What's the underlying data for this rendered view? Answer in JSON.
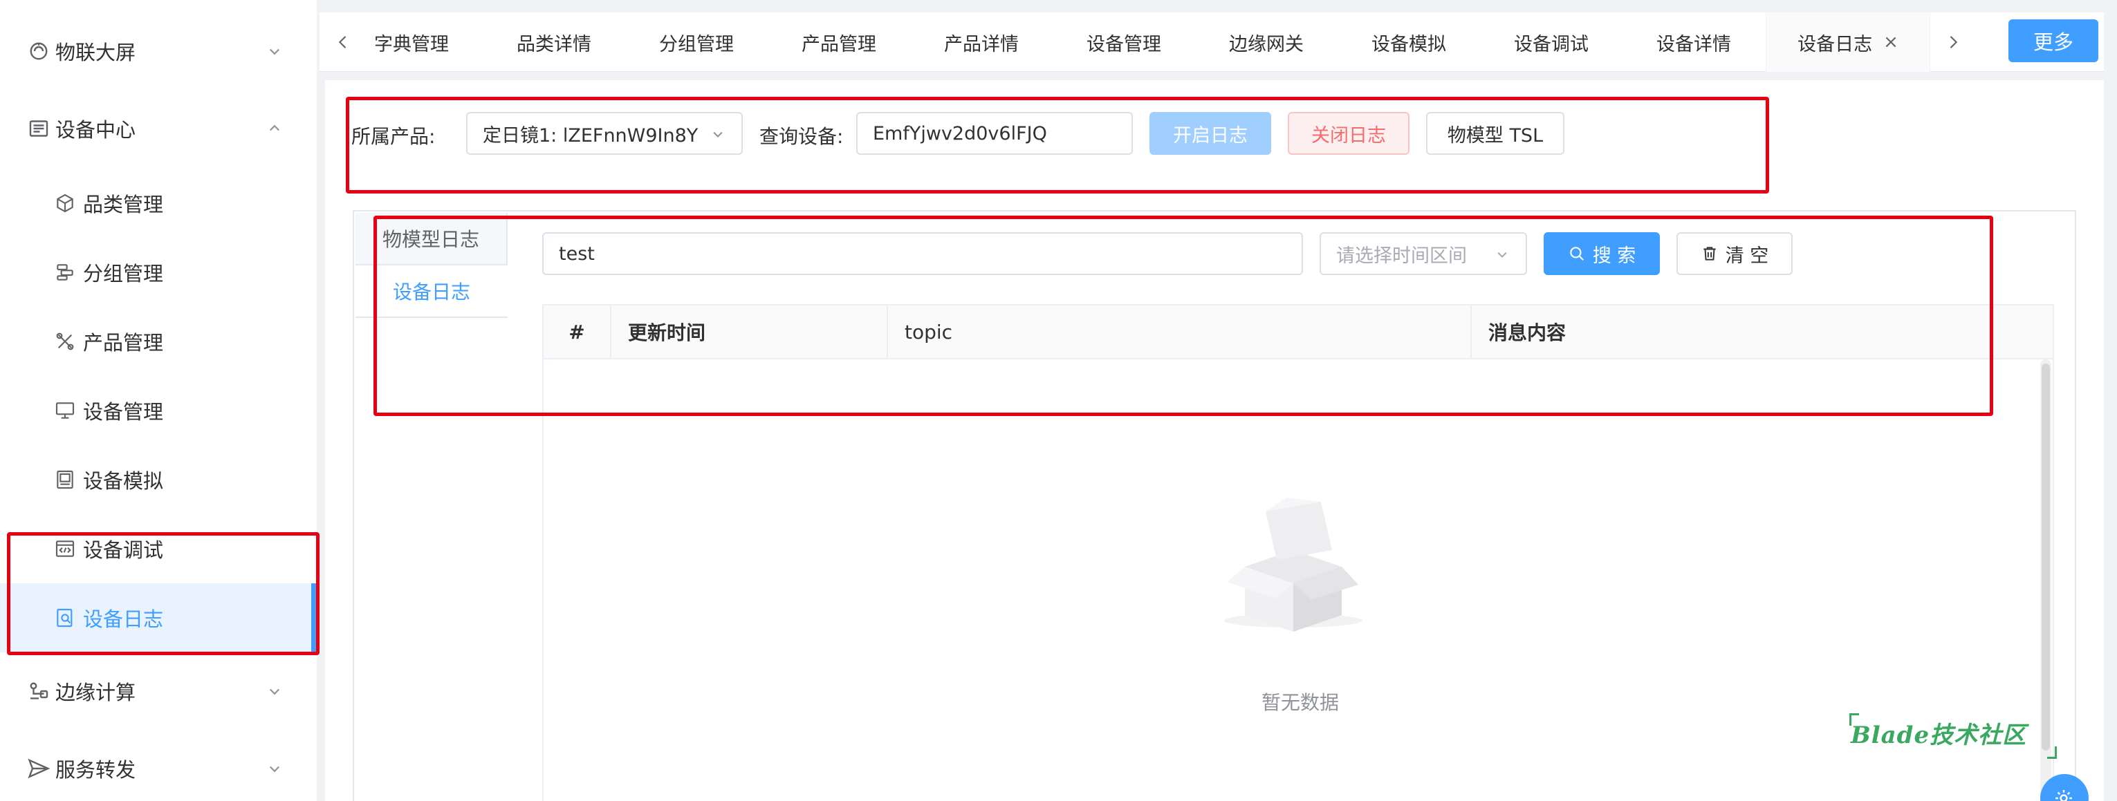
{
  "sidebar": {
    "groups": {
      "screen": "物联大屏",
      "device_center": "设备中心",
      "edge": "边缘计算",
      "forward": "服务转发"
    },
    "items": {
      "category": "品类管理",
      "group": "分组管理",
      "product": "产品管理",
      "device": "设备管理",
      "simulate": "设备模拟",
      "debug": "设备调试",
      "log": "设备日志"
    }
  },
  "tabs": {
    "t1": "字典管理",
    "t2": "品类详情",
    "t3": "分组管理",
    "t4": "产品管理",
    "t5": "产品详情",
    "t6": "设备管理",
    "t7": "边缘网关",
    "t8": "设备模拟",
    "t9": "设备调试",
    "t10": "设备详情",
    "t11": "设备日志",
    "more": "更多",
    "close_glyph": "×"
  },
  "filter": {
    "product_label": "所属产品:",
    "product_value": "定日镜1: lZEFnnW9In8Y",
    "device_label": "查询设备:",
    "device_value": "EmfYjwv2d0v6lFJQ",
    "open_log": "开启日志",
    "close_log": "关闭日志",
    "tsl": "物模型 TSL"
  },
  "log_tabs": {
    "model_log": "物模型日志",
    "device_log": "设备日志"
  },
  "search": {
    "keyword_value": "test",
    "time_placeholder": "请选择时间区间",
    "search_btn": "搜 索",
    "clear_btn": "清 空"
  },
  "table": {
    "columns": [
      "#",
      "更新时间",
      "topic",
      "消息内容"
    ],
    "empty_text": "暂无数据"
  },
  "watermark": "Blade技术社区",
  "colors": {
    "primary": "#409eff",
    "danger": "#f56c6c",
    "annotation": "#e60012",
    "watermark": "#3aa860"
  }
}
